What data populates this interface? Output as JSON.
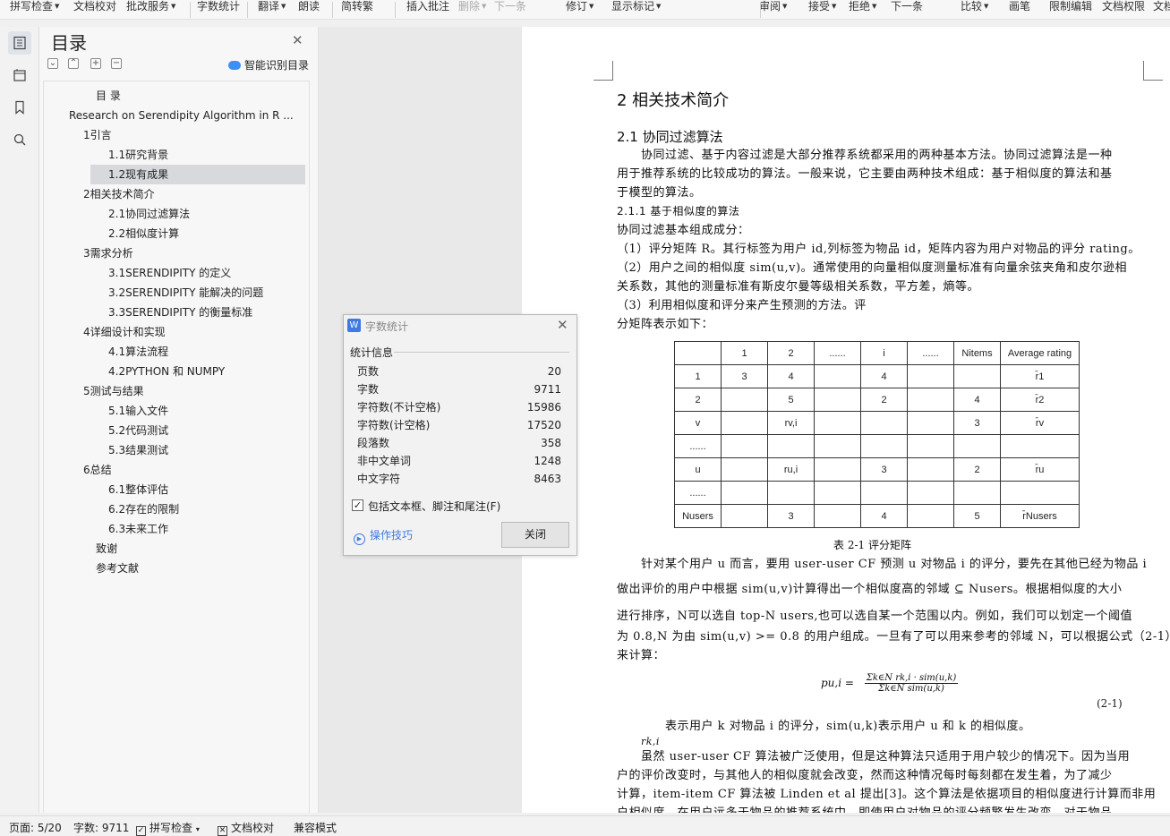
{
  "ribbon": {
    "items": [
      {
        "label": "拼写检查",
        "caret": true,
        "disabled": false
      },
      {
        "label": "文档校对",
        "caret": false,
        "disabled": false
      },
      {
        "label": "批改服务",
        "caret": true,
        "disabled": false
      },
      {
        "label": "字数统计",
        "caret": false,
        "disabled": false
      },
      {
        "label": "翻译",
        "caret": true,
        "disabled": false
      },
      {
        "label": "朗读",
        "caret": false,
        "disabled": false
      },
      {
        "label": "简转繁",
        "caret": false,
        "disabled": false
      },
      {
        "label": "插入批注",
        "caret": false,
        "disabled": false
      },
      {
        "label": "删除",
        "caret": true,
        "disabled": true
      },
      {
        "label": "下一条",
        "caret": false,
        "disabled": true
      },
      {
        "label": "修订",
        "caret": true,
        "disabled": false
      },
      {
        "label": "显示标记",
        "caret": true,
        "disabled": false
      },
      {
        "label": "审阅",
        "caret": true,
        "disabled": false
      },
      {
        "label": "接受",
        "caret": true,
        "disabled": false
      },
      {
        "label": "拒绝",
        "caret": true,
        "disabled": false
      },
      {
        "label": "下一条",
        "caret": false,
        "disabled": false
      },
      {
        "label": "比较",
        "caret": true,
        "disabled": false
      },
      {
        "label": "画笔",
        "caret": false,
        "disabled": false
      },
      {
        "label": "限制编辑",
        "caret": false,
        "disabled": false
      },
      {
        "label": "文档权限",
        "caret": false,
        "disabled": false
      },
      {
        "label": "文档",
        "caret": false,
        "disabled": false
      }
    ]
  },
  "toc": {
    "title": "目录",
    "smart_label": "智能识别目录",
    "items": [
      {
        "label": "目 录",
        "level": 0,
        "toggle": "",
        "selected": false
      },
      {
        "label": "Research on Serendipity Algorithm in R ...",
        "level": 1,
        "toggle": "open",
        "selected": false
      },
      {
        "label": "1引言",
        "level": 2,
        "toggle": "open",
        "selected": false
      },
      {
        "label": "1.1研究背景",
        "level": 3,
        "toggle": "",
        "selected": false
      },
      {
        "label": "1.2现有成果",
        "level": 3,
        "toggle": "",
        "selected": true
      },
      {
        "label": "2相关技术简介",
        "level": 2,
        "toggle": "open",
        "selected": false
      },
      {
        "label": "2.1协同过滤算法",
        "level": 3,
        "toggle": "",
        "selected": false
      },
      {
        "label": "2.2相似度计算",
        "level": 3,
        "toggle": "",
        "selected": false
      },
      {
        "label": "3需求分析",
        "level": 2,
        "toggle": "open",
        "selected": false
      },
      {
        "label": "3.1SERENDIPITY 的定义",
        "level": 3,
        "toggle": "",
        "selected": false
      },
      {
        "label": "3.2SERENDIPITY 能解决的问题",
        "level": 3,
        "toggle": "",
        "selected": false
      },
      {
        "label": "3.3SERENDIPITY 的衡量标准",
        "level": 3,
        "toggle": "",
        "selected": false
      },
      {
        "label": "4详细设计和实现",
        "level": 2,
        "toggle": "open",
        "selected": false
      },
      {
        "label": "4.1算法流程",
        "level": 3,
        "toggle": "",
        "selected": false
      },
      {
        "label": "4.2PYTHON 和 NUMPY",
        "level": 3,
        "toggle": "",
        "selected": false
      },
      {
        "label": "5测试与结果",
        "level": 2,
        "toggle": "open",
        "selected": false
      },
      {
        "label": "5.1输入文件",
        "level": 3,
        "toggle": "",
        "selected": false
      },
      {
        "label": "5.2代码测试",
        "level": 3,
        "toggle": "",
        "selected": false
      },
      {
        "label": "5.3结果测试",
        "level": 3,
        "toggle": "",
        "selected": false
      },
      {
        "label": "6总结",
        "level": 2,
        "toggle": "open",
        "selected": false
      },
      {
        "label": "6.1整体评估",
        "level": 3,
        "toggle": "",
        "selected": false
      },
      {
        "label": "6.2存在的限制",
        "level": 3,
        "toggle": "",
        "selected": false
      },
      {
        "label": "6.3未来工作",
        "level": 3,
        "toggle": "",
        "selected": false
      },
      {
        "label": "致谢",
        "level": 0,
        "toggle": "",
        "selected": false
      },
      {
        "label": "参考文献",
        "level": 0,
        "toggle": "",
        "selected": false
      }
    ]
  },
  "dialog": {
    "title": "字数统计",
    "section": "统计信息",
    "rows": [
      {
        "label": "页数",
        "value": "20"
      },
      {
        "label": "字数",
        "value": "9711"
      },
      {
        "label": "字符数(不计空格)",
        "value": "15986"
      },
      {
        "label": "字符数(计空格)",
        "value": "17520"
      },
      {
        "label": "段落数",
        "value": "358"
      },
      {
        "label": "非中文单词",
        "value": "1248"
      },
      {
        "label": "中文字符",
        "value": "8463"
      }
    ],
    "checkbox_label": "包括文本框、脚注和尾注(F)",
    "checkbox_checked": true,
    "tips_label": "操作技巧",
    "close_label": "关闭"
  },
  "doc": {
    "h1": "2 相关技术简介",
    "h2": "2.1 协同过滤算法",
    "paragraphs": [
      "　　协同过滤、基于内容过滤是大部分推荐系统都采用的两种基本方法。协同过滤算法是一种",
      "用于推荐系统的比较成功的算法。一般来说，它主要由两种技术组成：基于相似度的算法和基",
      "于模型的算法。",
      "2.1.1 基于相似度的算法",
      "协同过滤基本组成成分：",
      "（1）评分矩阵 R。其行标签为用户 id,列标签为物品 id，矩阵内容为用户对物品的评分 rating。",
      "（2）用户之间的相似度 sim(u,v)。通常使用的向量相似度测量标准有向量余弦夹角和皮尔逊相",
      "关系数，其他的测量标准有斯皮尔曼等级相关系数，平方差，熵等。",
      "（3）利用相似度和评分来产生预测的方法。评",
      "分矩阵表示如下："
    ],
    "table": {
      "rows": [
        [
          "",
          "1",
          "2",
          "......",
          "i",
          "......",
          "Nitems",
          "Average rating"
        ],
        [
          "1",
          "3",
          "4",
          "",
          "4",
          "",
          "",
          "r̄1"
        ],
        [
          "2",
          "",
          "5",
          "",
          "2",
          "",
          "4",
          "r̄2"
        ],
        [
          "v",
          "",
          "rv,i",
          "",
          "",
          "",
          "3",
          "r̄v"
        ],
        [
          "......",
          "",
          "",
          "",
          "",
          "",
          "",
          ""
        ],
        [
          "u",
          "",
          "ru,i",
          "",
          "3",
          "",
          "2",
          "r̄u"
        ],
        [
          "......",
          "",
          "",
          "",
          "",
          "",
          "",
          ""
        ],
        [
          "Nusers",
          "",
          "3",
          "",
          "4",
          "",
          "5",
          "r̄Nusers"
        ]
      ]
    },
    "caption": "表 2-1 评分矩阵",
    "after": [
      "　　针对某个用户 u 而言，要用 user-user CF 预测 u 对物品 i 的评分，要先在其他已经为物品 i",
      "做出评价的用户中根据 sim(u,v)计算得出一个相似度高的邻域 ⊆ Nusers。根据相似度的大小",
      "进行排序，N可以选自 top-N users,也可以选自某一个范围以内。例如，我们可以划定一个阈值",
      "为 0.8,N 为由 sim(u,v) >= 0.8 的用户组成。一旦有了可以用来参考的邻域 N，可以根据公式（2-1）",
      "来计算："
    ],
    "formula_lhs": "pu,i =",
    "formula_num": "Σk∈N rk,i · sim(u,k)",
    "formula_den": "Σk∈N sim(u,k)",
    "eq_no": "(2-1)",
    "tail": [
      "　　　　表示用户 k 对物品 i 的评分，sim(u,k)表示用户 u 和 k 的相似度。",
      "rk,i",
      "　　虽然 user-user CF 算法被广泛使用，但是这种算法只适用于用户较少的情况下。因为当用",
      "户的评价改变时，与其他人的相似度就会改变，然而这种情况每时每刻都在发生着，为了减少",
      "计算，item-item CF 算法被 Linden et al 提出[3]。这个算法是依据项目的相似度进行计算而非用",
      "户相似度。在用户远多于物品的推荐系统中，即使用户对物品的评分频繁发生改变，对于物品"
    ]
  },
  "status": {
    "page": "页面: 5/20",
    "words": "字数: 9711",
    "spell": "拼写检查",
    "proof": "文档校对",
    "compat": "兼容模式"
  }
}
